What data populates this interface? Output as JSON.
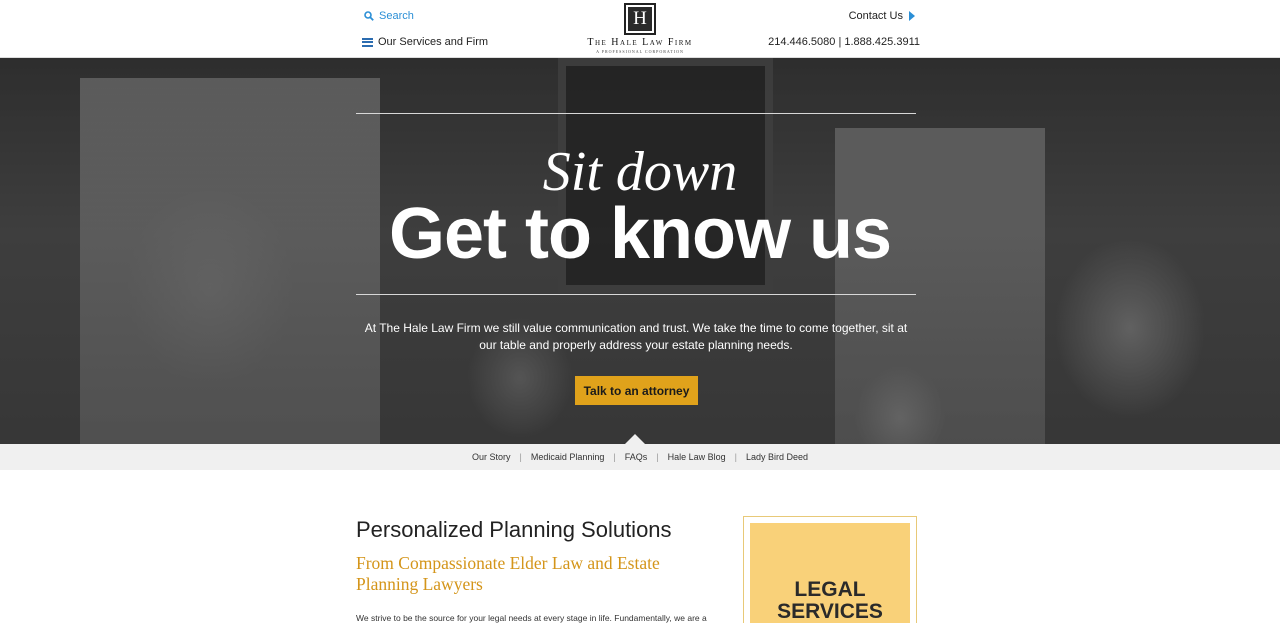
{
  "header": {
    "search_label": "Search",
    "menu_label": "Our Services and Firm",
    "contact_label": "Contact Us",
    "phone": "214.446.5080 | 1.888.425.3911",
    "logo": {
      "letter": "H",
      "name": "The Hale Law Firm",
      "tagline": "A PROFESSIONAL CORPORATION"
    }
  },
  "hero": {
    "script_heading": "Sit down",
    "main_heading": "Get to know us",
    "lead": "At The Hale Law Firm we still value communication and trust. We take the time to come together, sit at our table and properly address your estate planning needs.",
    "cta_label": "Talk to an attorney"
  },
  "subnav": {
    "items": [
      {
        "label": "Our Story"
      },
      {
        "label": "Medicaid Planning"
      },
      {
        "label": "FAQs"
      },
      {
        "label": "Hale Law Blog"
      },
      {
        "label": "Lady Bird Deed"
      }
    ],
    "separator": "|"
  },
  "content": {
    "title": "Personalized Planning Solutions",
    "subtitle": "From Compassionate Elder Law and Estate Planning Lawyers",
    "body": "We strive to be the source for your legal needs at every stage in life. Fundamentally, we are a wealth"
  },
  "sidebar": {
    "services_line1": "LEGAL",
    "services_line2": "SERVICES"
  },
  "colors": {
    "accent_gold": "#e0a21b",
    "subtitle_gold": "#d4951a",
    "link_blue": "#2b8fd6",
    "services_bg": "#f9d179"
  }
}
